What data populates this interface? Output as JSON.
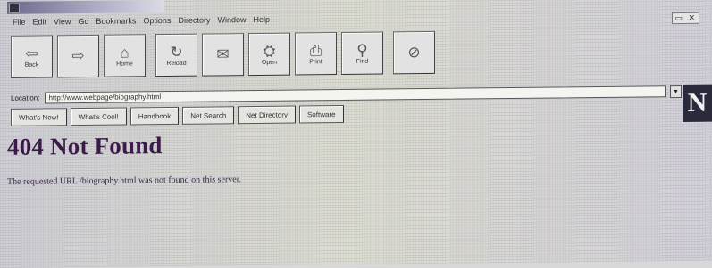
{
  "menubar": {
    "items": [
      "File",
      "Edit",
      "View",
      "Go",
      "Bookmarks",
      "Options",
      "Directory",
      "Window",
      "Help"
    ]
  },
  "toolbar": {
    "buttons": [
      {
        "label": "Back",
        "icon": "back-arrow-icon",
        "glyph": "⇦"
      },
      {
        "label": "",
        "icon": "forward-arrow-icon",
        "glyph": "⇨"
      },
      {
        "label": "Home",
        "icon": "home-icon",
        "glyph": "⌂"
      },
      {
        "label": "Reload",
        "icon": "reload-icon",
        "glyph": "↻"
      },
      {
        "label": "",
        "icon": "images-icon",
        "glyph": "✉"
      },
      {
        "label": "Open",
        "icon": "open-icon",
        "glyph": "⛭"
      },
      {
        "label": "Print",
        "icon": "print-icon",
        "glyph": "⎙"
      },
      {
        "label": "Find",
        "icon": "find-icon",
        "glyph": "⚲"
      },
      {
        "label": "",
        "icon": "stop-icon",
        "glyph": "⊘"
      }
    ]
  },
  "location": {
    "label": "Location:",
    "value": "http://www.webpage/biography.html"
  },
  "directory": {
    "buttons": [
      "What's New!",
      "What's Cool!",
      "Handbook",
      "Net Search",
      "Net Directory",
      "Software"
    ]
  },
  "logo": {
    "text": "N"
  },
  "page": {
    "heading": "404 Not Found",
    "message": "The requested URL /biography.html was not found on this server."
  },
  "colors": {
    "heading": "#3a1a48",
    "logo_bg": "#2a2a3c"
  }
}
